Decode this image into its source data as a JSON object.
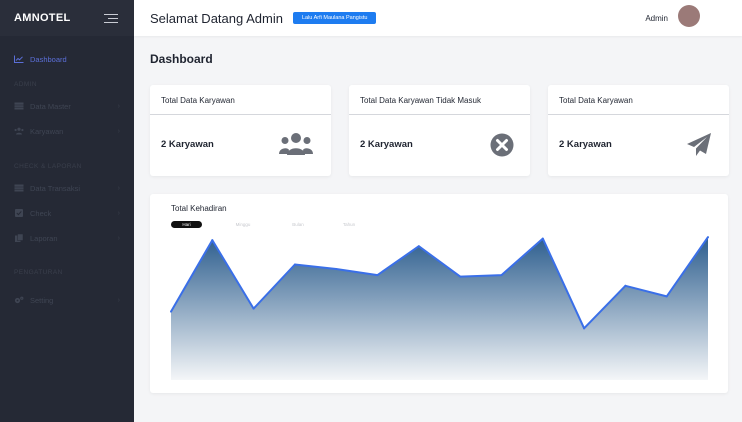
{
  "brand": "AMNOTEL",
  "sidebar": {
    "items": [
      {
        "label": "Dashboard",
        "icon": "chart-line-icon"
      },
      {
        "label": "Data Master",
        "icon": "table-icon"
      },
      {
        "label": "Karyawan",
        "icon": "users-icon"
      },
      {
        "label": "Data Transaksi",
        "icon": "table-icon"
      },
      {
        "label": "Check",
        "icon": "check-square-icon"
      },
      {
        "label": "Laporan",
        "icon": "copy-icon"
      },
      {
        "label": "Setting",
        "icon": "cogs-icon"
      }
    ],
    "headings": [
      "ADMIN",
      "CHECK & LAPORAN",
      "PENGATURAN"
    ]
  },
  "header": {
    "welcome": "Selamat Datang Admin",
    "user_pill": "Lalu Arfi Maulana Pangistu",
    "admin_label": "Admin"
  },
  "page_title": "Dashboard",
  "cards": [
    {
      "title": "Total Data Karyawan",
      "value": "2 Karyawan",
      "icon": "users-icon"
    },
    {
      "title": "Total Data Karyawan Tidak Masuk",
      "value": "2 Karyawan",
      "icon": "times-circle-icon"
    },
    {
      "title": "Total Data Karyawan",
      "value": "2 Karyawan",
      "icon": "paper-plane-icon"
    }
  ],
  "attendance": {
    "title": "Total Kehadiran",
    "tabs": [
      "Hari",
      "Minggu",
      "Bulan",
      "Tahun"
    ],
    "active_tab": "Hari"
  },
  "chart_data": {
    "type": "area",
    "title": "Total Kehadiran",
    "values": [
      45,
      92,
      47,
      76,
      73,
      69,
      88,
      68,
      69,
      93,
      34,
      62,
      55,
      94
    ],
    "ylim": [
      0,
      100
    ],
    "xlabel": "",
    "ylabel": "",
    "grid": false,
    "colors": {
      "line": "#3a6fe8",
      "fill_top": "#2d5e8e",
      "fill_bottom": "#f4f6f8"
    }
  },
  "colors": {
    "accent": "#1e7cf0",
    "sidebar": "#252935",
    "active": "#5b6fd8"
  }
}
